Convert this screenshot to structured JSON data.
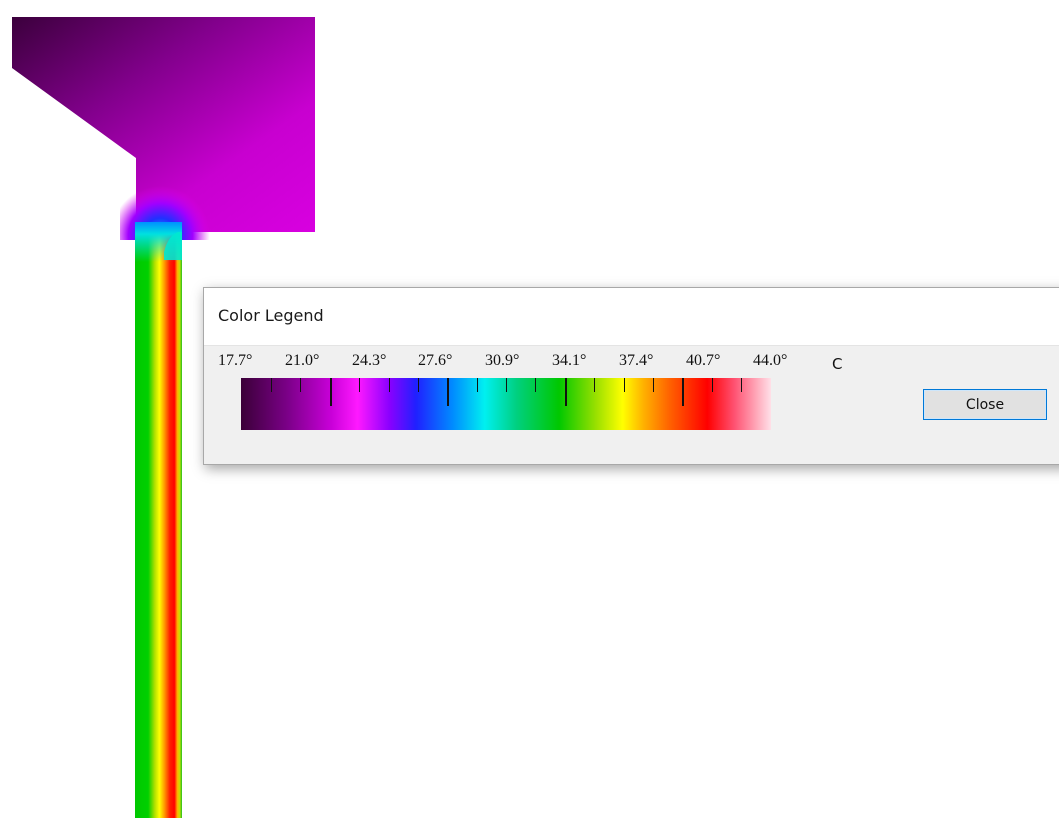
{
  "dialog": {
    "title": "Color Legend",
    "close_label": "Close",
    "unit": "C"
  },
  "legend": {
    "labels": [
      "17.7°",
      "21.0°",
      "24.3°",
      "27.6°",
      "30.9°",
      "34.1°",
      "37.4°",
      "40.7°",
      "44.0°"
    ],
    "min": 17.7,
    "max": 44.0,
    "colors": [
      "#3a0038",
      "#c800d8",
      "#ff19ff",
      "#2020ff",
      "#00f0f0",
      "#00c800",
      "#ffff00",
      "#ff0000",
      "#ffe0e8"
    ]
  },
  "plot": {
    "background": "#ffffff",
    "hot_color": "#ff0000",
    "cold_color": "#3a0038"
  }
}
